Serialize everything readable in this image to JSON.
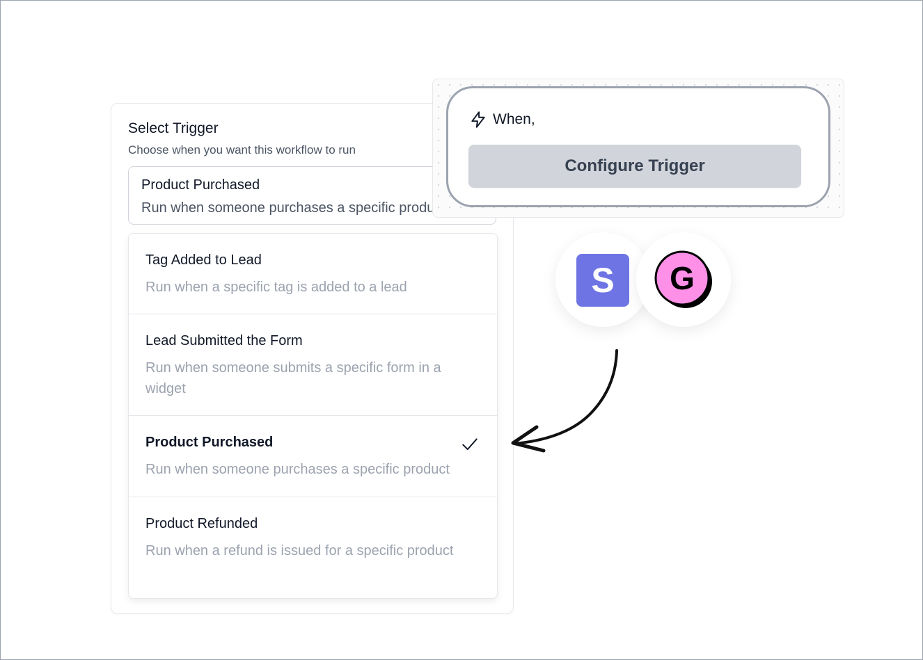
{
  "panel": {
    "title": "Select Trigger",
    "subtitle": "Choose when you want this workflow to run",
    "selected": {
      "title": "Product Purchased",
      "description": "Run when someone purchases a specific product"
    }
  },
  "options": [
    {
      "title": "Tag Added to Lead",
      "description": "Run when a specific tag is added to a lead",
      "selected": false
    },
    {
      "title": "Lead Submitted the Form",
      "description": "Run when someone submits a specific form in a widget",
      "selected": false
    },
    {
      "title": "Product Purchased",
      "description": "Run when someone purchases a specific product",
      "selected": true
    },
    {
      "title": "Product Refunded",
      "description": "Run when a refund is issued for a specific product",
      "selected": false
    }
  ],
  "when_card": {
    "label": "When,",
    "button_label": "Configure Trigger",
    "icon": "lightning-bolt-icon"
  },
  "logos": [
    {
      "letter": "S",
      "color": "#6e74e3",
      "icon": "stripe-logo-icon"
    },
    {
      "letter": "G",
      "color": "#ff90e8",
      "icon": "gumroad-logo-icon"
    }
  ],
  "colors": {
    "button_bg": "#d1d5db",
    "muted_text": "#9ca3af",
    "card_border": "#9ca3af"
  }
}
